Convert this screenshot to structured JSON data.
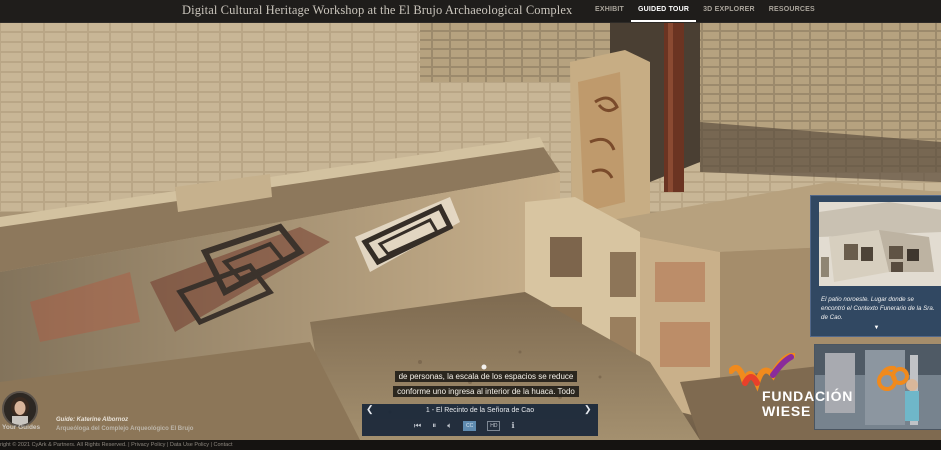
{
  "header": {
    "title": "Digital Cultural Heritage Workshop at the El Brujo Archaeological Complex",
    "nav": [
      {
        "label": "EXHIBIT",
        "active": false
      },
      {
        "label": "GUIDED TOUR",
        "active": true
      },
      {
        "label": "3D EXPLORER",
        "active": false
      },
      {
        "label": "RESOURCES",
        "active": false
      }
    ]
  },
  "info_panel": {
    "caption": "El patio noroeste. Lugar donde se encontró el Contexto Funerario de la Sra. de Cao.",
    "chevron_icon": "chevron-down-icon"
  },
  "subtitle": {
    "line1": "de personas, la escala de los espacios se reduce",
    "line2": "conforme uno ingresa al interior de la huaca. Todo"
  },
  "guide": {
    "section_label": "Your Guides",
    "name": "Guide: Katerine Albornoz",
    "role": "Arqueóloga del Complejo Arqueológico El Brujo"
  },
  "player": {
    "chapter": "1 - El Recinto de la Señora de Cao",
    "prev_icon": "chevron-left-icon",
    "next_icon": "chevron-right-icon",
    "cc_label": "CC",
    "hd_label": "HD"
  },
  "logo": {
    "line1": "FUNDACIÓN",
    "line2": "WIESE",
    "brand_colors": [
      "#e8402a",
      "#f08a1d",
      "#8a2b9a"
    ]
  },
  "footer": {
    "copyright": "right © 2021 CyArk & Partners. All Rights Reserved.",
    "links": [
      "Privacy Policy",
      "Data Use Policy",
      "Contact"
    ]
  }
}
